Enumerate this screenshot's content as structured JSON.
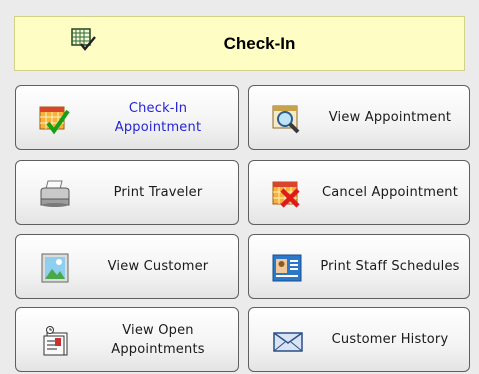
{
  "header": {
    "title": "Check-In",
    "icon": "calendar-check-icon"
  },
  "buttons": {
    "check_in_appointment": {
      "label": "Check-In Appointment",
      "icon": "calendar-check-icon",
      "color": "#2323d8"
    },
    "view_appointment": {
      "label": "View Appointment",
      "icon": "magnifier-calendar-icon"
    },
    "print_traveler": {
      "label": "Print Traveler",
      "icon": "printer-icon"
    },
    "cancel_appointment": {
      "label": "Cancel Appointment",
      "icon": "calendar-x-icon"
    },
    "view_customer": {
      "label": "View Customer",
      "icon": "picture-icon"
    },
    "print_staff_schedules": {
      "label": "Print Staff Schedules",
      "icon": "id-card-icon"
    },
    "view_open_appointments": {
      "label": "View Open Appointments",
      "icon": "document-stack-icon"
    },
    "customer_history": {
      "label": "Customer History",
      "icon": "envelope-icon"
    }
  }
}
